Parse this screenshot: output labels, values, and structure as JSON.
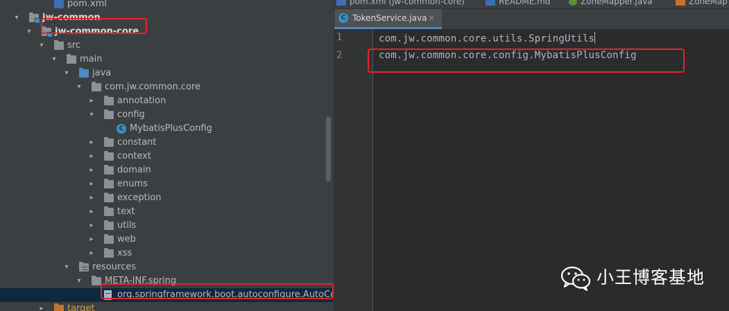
{
  "project_tree": {
    "items": [
      {
        "label": "pom.xml",
        "icon": "maven-icon",
        "depth": 3,
        "expander": "none"
      },
      {
        "label": "jw-common",
        "icon": "module-folder-icon",
        "depth": 1,
        "expander": "expanded",
        "bold": true
      },
      {
        "label": "jw-common-core",
        "icon": "module-folder-icon",
        "depth": 2,
        "expander": "expanded",
        "bold": true
      },
      {
        "label": "src",
        "icon": "folder-icon",
        "depth": 3,
        "expander": "expanded"
      },
      {
        "label": "main",
        "icon": "folder-icon",
        "depth": 4,
        "expander": "expanded"
      },
      {
        "label": "java",
        "icon": "source-folder-icon",
        "depth": 5,
        "expander": "expanded"
      },
      {
        "label": "com.jw.common.core",
        "icon": "package-icon",
        "depth": 6,
        "expander": "expanded"
      },
      {
        "label": "annotation",
        "icon": "package-icon",
        "depth": 7,
        "expander": "collapsed"
      },
      {
        "label": "config",
        "icon": "package-icon",
        "depth": 7,
        "expander": "expanded"
      },
      {
        "label": "MybatisPlusConfig",
        "icon": "class-icon",
        "depth": 8,
        "expander": "none"
      },
      {
        "label": "constant",
        "icon": "package-icon",
        "depth": 7,
        "expander": "collapsed"
      },
      {
        "label": "context",
        "icon": "package-icon",
        "depth": 7,
        "expander": "collapsed"
      },
      {
        "label": "domain",
        "icon": "package-icon",
        "depth": 7,
        "expander": "collapsed"
      },
      {
        "label": "enums",
        "icon": "package-icon",
        "depth": 7,
        "expander": "collapsed"
      },
      {
        "label": "exception",
        "icon": "package-icon",
        "depth": 7,
        "expander": "collapsed"
      },
      {
        "label": "text",
        "icon": "package-icon",
        "depth": 7,
        "expander": "collapsed"
      },
      {
        "label": "utils",
        "icon": "package-icon",
        "depth": 7,
        "expander": "collapsed"
      },
      {
        "label": "web",
        "icon": "package-icon",
        "depth": 7,
        "expander": "collapsed"
      },
      {
        "label": "xss",
        "icon": "package-icon",
        "depth": 7,
        "expander": "collapsed"
      },
      {
        "label": "resources",
        "icon": "resources-folder-icon",
        "depth": 5,
        "expander": "expanded"
      },
      {
        "label": "META-INF.spring",
        "icon": "folder-icon",
        "depth": 6,
        "expander": "expanded"
      },
      {
        "label": "org.springframework.boot.autoconfigure.AutoConfiguration.imports",
        "icon": "text-file-icon",
        "depth": 7,
        "expander": "none",
        "selected": true
      },
      {
        "label": "target",
        "icon": "excluded-folder-icon",
        "depth": 3,
        "expander": "collapsed",
        "excluded": true
      }
    ]
  },
  "editor": {
    "top_tabs": [
      {
        "label": "pom.xml (jw-common-core)",
        "icon": "maven-icon"
      },
      {
        "label": "README.md",
        "icon": "markdown-icon"
      },
      {
        "label": "ZoneMapper.java",
        "icon": "interface-icon"
      },
      {
        "label": "ZoneMap",
        "icon": "xml-icon"
      }
    ],
    "active_tab": {
      "label": "TokenService.java",
      "icon": "class-icon",
      "close": "×"
    },
    "lines": [
      {
        "number": "1",
        "text": "com.jw.common.core.utils.SpringUtils"
      },
      {
        "number": "2",
        "text": "com.jw.common.core.config.MybatisPlusConfig"
      }
    ]
  },
  "watermark": {
    "text": "小王博客基地",
    "icon": "wechat-icon"
  },
  "colors": {
    "panel_bg": "#3c3f41",
    "editor_bg": "#2b2b2b",
    "gutter_bg": "#313335",
    "selection_bg": "#0d293e",
    "annotation_red": "#e8232b",
    "class_icon_blue": "#3592c4",
    "excluded_orange": "#c7742a"
  }
}
